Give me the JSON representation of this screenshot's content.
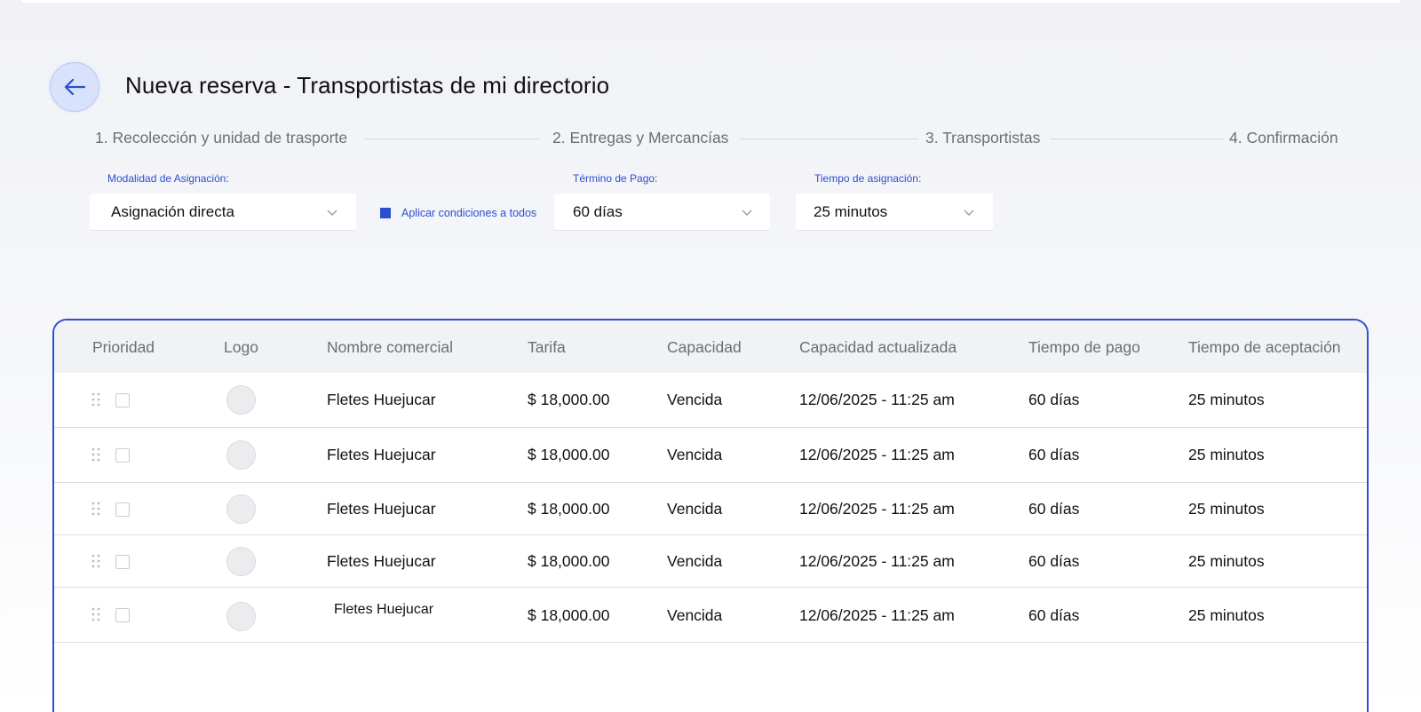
{
  "header": {
    "title": "Nueva reserva - Transportistas de mi directorio"
  },
  "stepper": {
    "steps": [
      "1. Recolección y unidad de trasporte",
      "2. Entregas y Mercancías",
      "3. Transportistas",
      "4. Confirmación"
    ]
  },
  "form": {
    "modalidad": {
      "label": "Modalidad de Asignación:",
      "value": "Asignación directa"
    },
    "apply_all": {
      "label": "Aplicar condiciones a todos",
      "checked": true
    },
    "termino": {
      "label": "Término de Pago:",
      "value": "60 días"
    },
    "tiempo": {
      "label": "Tiempo de asignación:",
      "value": "25 minutos"
    }
  },
  "table": {
    "columns": [
      "Prioridad",
      "Logo",
      "Nombre comercial",
      "Tarifa",
      "Capacidad",
      "Capacidad actualizada",
      "Tiempo de pago",
      "Tiempo de aceptación"
    ],
    "rows": [
      {
        "nombre": "Fletes Huejucar",
        "tarifa": "$ 18,000.00",
        "capacidad": "Vencida",
        "actualizada": "12/06/2025 - 11:25 am",
        "pago": "60 días",
        "aceptacion": "25 minutos"
      },
      {
        "nombre": "Fletes Huejucar",
        "tarifa": "$ 18,000.00",
        "capacidad": "Vencida",
        "actualizada": "12/06/2025 - 11:25 am",
        "pago": "60 días",
        "aceptacion": "25 minutos"
      },
      {
        "nombre": "Fletes Huejucar",
        "tarifa": "$ 18,000.00",
        "capacidad": "Vencida",
        "actualizada": "12/06/2025 - 11:25 am",
        "pago": "60 días",
        "aceptacion": "25 minutos"
      },
      {
        "nombre": "Fletes Huejucar",
        "tarifa": "$ 18,000.00",
        "capacidad": "Vencida",
        "actualizada": "12/06/2025 - 11:25 am",
        "pago": "60 días",
        "aceptacion": "25 minutos"
      },
      {
        "nombre": "Fletes Huejucar",
        "tarifa": "$ 18,000.00",
        "capacidad": "Vencida",
        "actualizada": "12/06/2025 - 11:25 am",
        "pago": "60 días",
        "aceptacion": "25 minutos"
      }
    ]
  },
  "icons": {
    "back": "arrow-left-icon",
    "select": "chevron-down-icon",
    "drag": "drag-handle-icon"
  },
  "colors": {
    "accent": "#2b4fd1",
    "card_border": "#2f50d0",
    "back_button_bg": "#d9e2fb",
    "header_bg": "#f1f2f5",
    "muted_text": "#6b6e76"
  }
}
